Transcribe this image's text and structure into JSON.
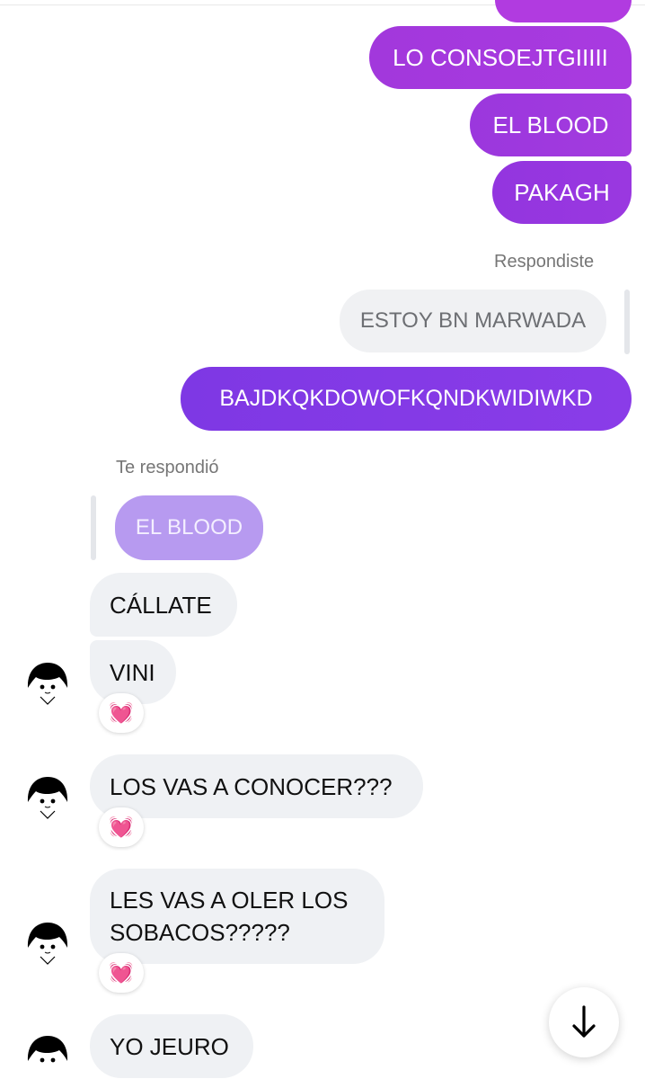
{
  "sent_messages": [
    {
      "text": ""
    },
    {
      "text": "LO CONSOEJTGIIIII"
    },
    {
      "text": "EL BLOOD"
    },
    {
      "text": "PAKAGH"
    },
    {
      "text": "BAJDKQKDOWOFKQNDKWIDIWKD"
    }
  ],
  "sent_reply": {
    "label": "Respondiste",
    "quoted_text": "ESTOY BN MARWADA"
  },
  "received_reply": {
    "label": "Te respondió",
    "quoted_text": "EL BLOOD"
  },
  "received_messages": [
    {
      "text": "CÁLLATE",
      "reaction": ""
    },
    {
      "text": "VINI",
      "reaction": "💓"
    },
    {
      "text": "LOS VAS A CONOCER???",
      "reaction": "💓"
    },
    {
      "text": "LES VAS A OLER LOS SOBACOS?????",
      "reaction": "💓"
    },
    {
      "text": "YO JEURO",
      "reaction": ""
    }
  ],
  "colors": {
    "sent_bubble": "#9a38e0",
    "received_bubble": "#eff1f4",
    "quoted_received_bubble": "#b79af0"
  },
  "icons": {
    "scroll_down": "arrow-down-icon",
    "reaction": "beating-heart-icon"
  }
}
